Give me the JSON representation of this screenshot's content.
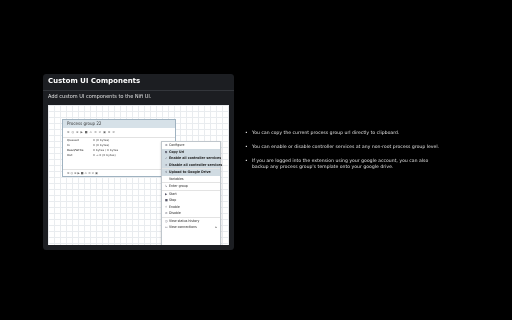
{
  "card": {
    "title": "Custom UI Components",
    "subtitle": "Add custom UI components to the Nifi UI."
  },
  "screenshot": {
    "process_group": {
      "name": "Process group 22",
      "toolbar_icons": "⊗ ◎ ⊕ ▶ ■ ⚠ ⊘ ⊙ ▣ ⊗ ⊘",
      "rows": [
        {
          "label": "Queued",
          "value": "0 (0 bytes)"
        },
        {
          "label": "In",
          "value": "0 (0 bytes)"
        },
        {
          "label": "Read/Write",
          "value": "0 bytes / 0 bytes"
        },
        {
          "label": "Out",
          "value": "0 → 0 (0 bytes)"
        }
      ],
      "footer_icons": "⊗ ◎ ⊕ ▶ ■ ⚠ ⊘ ⊙ ▣"
    },
    "context_menu": [
      {
        "icon": "⚙",
        "label": "Configure",
        "highlight": false,
        "sep": false
      },
      {
        "icon": "⧉",
        "label": "Copy Url",
        "highlight": true,
        "sep": false
      },
      {
        "icon": "✓",
        "label": "Enable all controller services",
        "highlight": true,
        "sep": false
      },
      {
        "icon": "✕",
        "label": "Disable all controller services",
        "highlight": true,
        "sep": true
      },
      {
        "icon": "⇪",
        "label": "Upload to Google Drive",
        "highlight": true,
        "sep": false
      },
      {
        "icon": "",
        "label": "Variables",
        "highlight": false,
        "sep": true
      },
      {
        "icon": "↳",
        "label": "Enter group",
        "highlight": false,
        "sep": true
      },
      {
        "icon": "▶",
        "label": "Start",
        "highlight": false,
        "sep": false
      },
      {
        "icon": "■",
        "label": "Stop",
        "highlight": false,
        "sep": false
      },
      {
        "icon": "⚡",
        "label": "Enable",
        "highlight": false,
        "sep": false
      },
      {
        "icon": "⊘",
        "label": "Disable",
        "highlight": false,
        "sep": true
      },
      {
        "icon": "◷",
        "label": "View status history",
        "highlight": false,
        "sep": false
      },
      {
        "icon": "↔",
        "label": "View connections",
        "highlight": false,
        "sep": false,
        "arrow": "▸"
      }
    ]
  },
  "bullets": [
    "You can copy the current process group url directly to clipboard.",
    "You can enable or disable controller services at any non-root process group level.",
    "If you are logged into the extension using your google account, you can also backup any process group's template onto your google drive."
  ]
}
